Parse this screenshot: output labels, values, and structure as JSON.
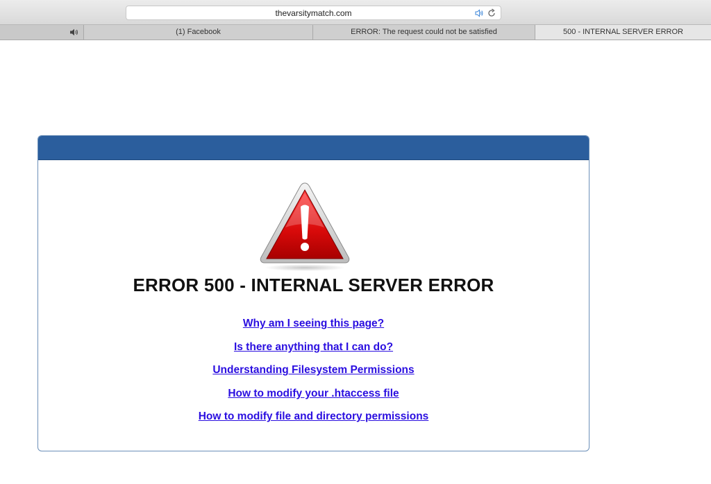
{
  "browser": {
    "address": "thevarsitymatch.com",
    "tabs": [
      {
        "label": "",
        "icon": "speaker-icon"
      },
      {
        "label": "(1) Facebook"
      },
      {
        "label": "ERROR: The request could not be satisfied"
      },
      {
        "label": "500 - INTERNAL SERVER ERROR"
      }
    ]
  },
  "page": {
    "header_color": "#2b5e9d",
    "icon": "warning-icon",
    "title": "ERROR 500 - INTERNAL SERVER ERROR",
    "links": [
      "Why am I seeing this page?",
      "Is there anything that I can do?",
      "Understanding Filesystem Permissions",
      "How to modify your .htaccess file",
      "How to modify file and directory permissions"
    ],
    "link_color": "#2a0ee0"
  }
}
